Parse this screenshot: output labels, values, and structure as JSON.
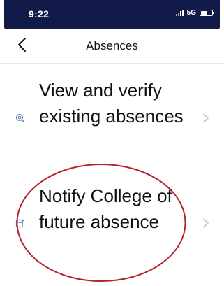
{
  "status_bar": {
    "time": "9:22",
    "network": "5G",
    "background_color": "#121a4a"
  },
  "nav": {
    "back_icon": "chevron-left-icon",
    "title": "Absences"
  },
  "items": [
    {
      "icon": "verify-search-icon",
      "label": "View and verify existing absences",
      "chevron": "chevron-right-icon"
    },
    {
      "icon": "edit-note-icon",
      "label": "Notify College of future absence",
      "chevron": "chevron-right-icon"
    }
  ],
  "colors": {
    "text": "#111111",
    "icon_accent": "#5b7bb5",
    "chevron": "#c7c7cc",
    "annotation": "#b3232b"
  }
}
